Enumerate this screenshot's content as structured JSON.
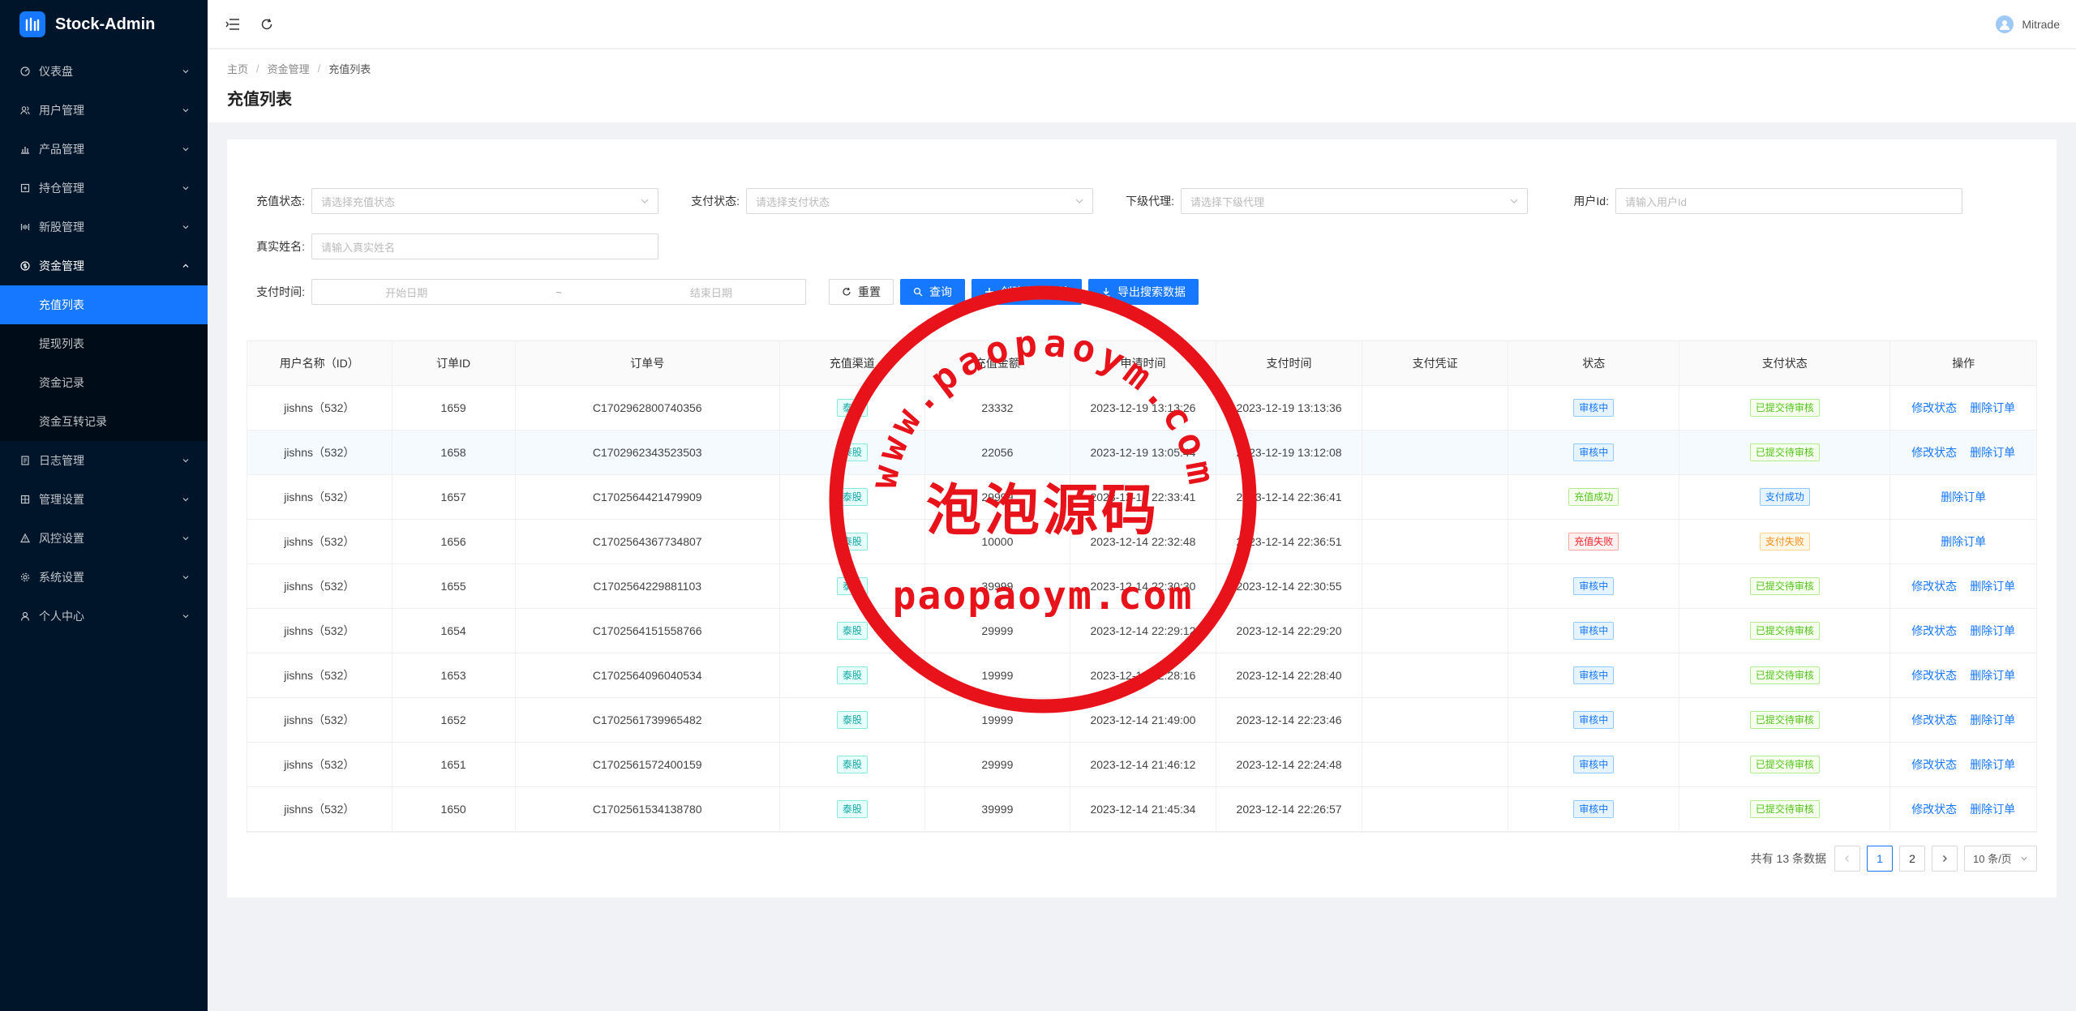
{
  "app": {
    "title": "Stock-Admin"
  },
  "sidebar": {
    "menu": [
      {
        "label": "仪表盘",
        "icon": "dashboard-icon"
      },
      {
        "label": "用户管理",
        "icon": "users-icon"
      },
      {
        "label": "产品管理",
        "icon": "chart-icon"
      },
      {
        "label": "持仓管理",
        "icon": "position-icon"
      },
      {
        "label": "新股管理",
        "icon": "ipo-icon"
      },
      {
        "label": "资金管理",
        "icon": "funds-icon",
        "open": true,
        "children": [
          "充值列表",
          "提现列表",
          "资金记录",
          "资金互转记录"
        ]
      },
      {
        "label": "日志管理",
        "icon": "log-icon"
      },
      {
        "label": "管理设置",
        "icon": "settings-grid-icon"
      },
      {
        "label": "风控设置",
        "icon": "warning-icon"
      },
      {
        "label": "系统设置",
        "icon": "gear-icon"
      },
      {
        "label": "个人中心",
        "icon": "user-icon"
      }
    ],
    "active_child": "充值列表"
  },
  "header": {
    "username": "Mitrade"
  },
  "breadcrumb": {
    "home": "主页",
    "parent": "资金管理",
    "current": "充值列表"
  },
  "page": {
    "title": "充值列表"
  },
  "filters": {
    "recharge_status": {
      "label": "充值状态:",
      "placeholder": "请选择充值状态"
    },
    "pay_status": {
      "label": "支付状态:",
      "placeholder": "请选择支付状态"
    },
    "agent": {
      "label": "下级代理:",
      "placeholder": "请选择下级代理"
    },
    "user_id": {
      "label": "用户Id:",
      "placeholder": "请输入用户Id"
    },
    "real_name": {
      "label": "真实姓名:",
      "placeholder": "请输入真实姓名"
    },
    "pay_time": {
      "label": "支付时间:",
      "start": "开始日期",
      "sep": "~",
      "end": "结束日期"
    }
  },
  "buttons": {
    "reset": "重置",
    "search": "查询",
    "create": "创建充值订单",
    "export": "导出搜索数据"
  },
  "table": {
    "columns": [
      "用户名称（ID）",
      "订单ID",
      "订单号",
      "充值渠道",
      "充值金额",
      "申请时间",
      "支付时间",
      "支付凭证",
      "状态",
      "支付状态",
      "操作"
    ],
    "rows": [
      {
        "user": "jishns（532）",
        "id": "1659",
        "order": "C1702962800740356",
        "channel": "泰股",
        "amount": "23332",
        "apply": "2023-12-19 13:13:26",
        "paid": "2023-12-19 13:13:36",
        "status": "审核中",
        "pay": "已提交待审核",
        "ops": [
          "修改状态",
          "删除订单"
        ]
      },
      {
        "user": "jishns（532）",
        "id": "1658",
        "order": "C1702962343523503",
        "channel": "泰股",
        "amount": "22056",
        "apply": "2023-12-19 13:05:44",
        "paid": "2023-12-19 13:12:08",
        "status": "审核中",
        "pay": "已提交待审核",
        "ops": [
          "修改状态",
          "删除订单"
        ]
      },
      {
        "user": "jishns（532）",
        "id": "1657",
        "order": "C1702564421479909",
        "channel": "泰股",
        "amount": "29999",
        "apply": "2023-12-14 22:33:41",
        "paid": "2023-12-14 22:36:41",
        "status": "充值成功",
        "pay": "支付成功",
        "ops": [
          "删除订单"
        ]
      },
      {
        "user": "jishns（532）",
        "id": "1656",
        "order": "C1702564367734807",
        "channel": "泰股",
        "amount": "10000",
        "apply": "2023-12-14 22:32:48",
        "paid": "2023-12-14 22:36:51",
        "status": "充值失败",
        "pay": "支付失败",
        "ops": [
          "删除订单"
        ]
      },
      {
        "user": "jishns（532）",
        "id": "1655",
        "order": "C1702564229881103",
        "channel": "泰股",
        "amount": "39999",
        "apply": "2023-12-14 22:30:30",
        "paid": "2023-12-14 22:30:55",
        "status": "审核中",
        "pay": "已提交待审核",
        "ops": [
          "修改状态",
          "删除订单"
        ]
      },
      {
        "user": "jishns（532）",
        "id": "1654",
        "order": "C1702564151558766",
        "channel": "泰股",
        "amount": "29999",
        "apply": "2023-12-14 22:29:12",
        "paid": "2023-12-14 22:29:20",
        "status": "审核中",
        "pay": "已提交待审核",
        "ops": [
          "修改状态",
          "删除订单"
        ]
      },
      {
        "user": "jishns（532）",
        "id": "1653",
        "order": "C1702564096040534",
        "channel": "泰股",
        "amount": "19999",
        "apply": "2023-12-14 22:28:16",
        "paid": "2023-12-14 22:28:40",
        "status": "审核中",
        "pay": "已提交待审核",
        "ops": [
          "修改状态",
          "删除订单"
        ]
      },
      {
        "user": "jishns（532）",
        "id": "1652",
        "order": "C1702561739965482",
        "channel": "泰股",
        "amount": "19999",
        "apply": "2023-12-14 21:49:00",
        "paid": "2023-12-14 22:23:46",
        "status": "审核中",
        "pay": "已提交待审核",
        "ops": [
          "修改状态",
          "删除订单"
        ]
      },
      {
        "user": "jishns（532）",
        "id": "1651",
        "order": "C1702561572400159",
        "channel": "泰股",
        "amount": "29999",
        "apply": "2023-12-14 21:46:12",
        "paid": "2023-12-14 22:24:48",
        "status": "审核中",
        "pay": "已提交待审核",
        "ops": [
          "修改状态",
          "删除订单"
        ]
      },
      {
        "user": "jishns（532）",
        "id": "1650",
        "order": "C1702561534138780",
        "channel": "泰股",
        "amount": "39999",
        "apply": "2023-12-14 21:45:34",
        "paid": "2023-12-14 22:26:57",
        "status": "审核中",
        "pay": "已提交待审核",
        "ops": [
          "修改状态",
          "删除订单"
        ]
      }
    ]
  },
  "pagination": {
    "total": "共有 13 条数据",
    "pages": [
      "1",
      "2"
    ],
    "current": "1",
    "page_size": "10 条/页"
  },
  "watermark": {
    "arc_text": "www.paopaoym.com",
    "cn_text": "泡泡源码",
    "domain_text": "paopaoym.com",
    "color": "#e8131a"
  },
  "colors": {
    "sidebar_bg": "#001529",
    "primary": "#1677ff"
  }
}
